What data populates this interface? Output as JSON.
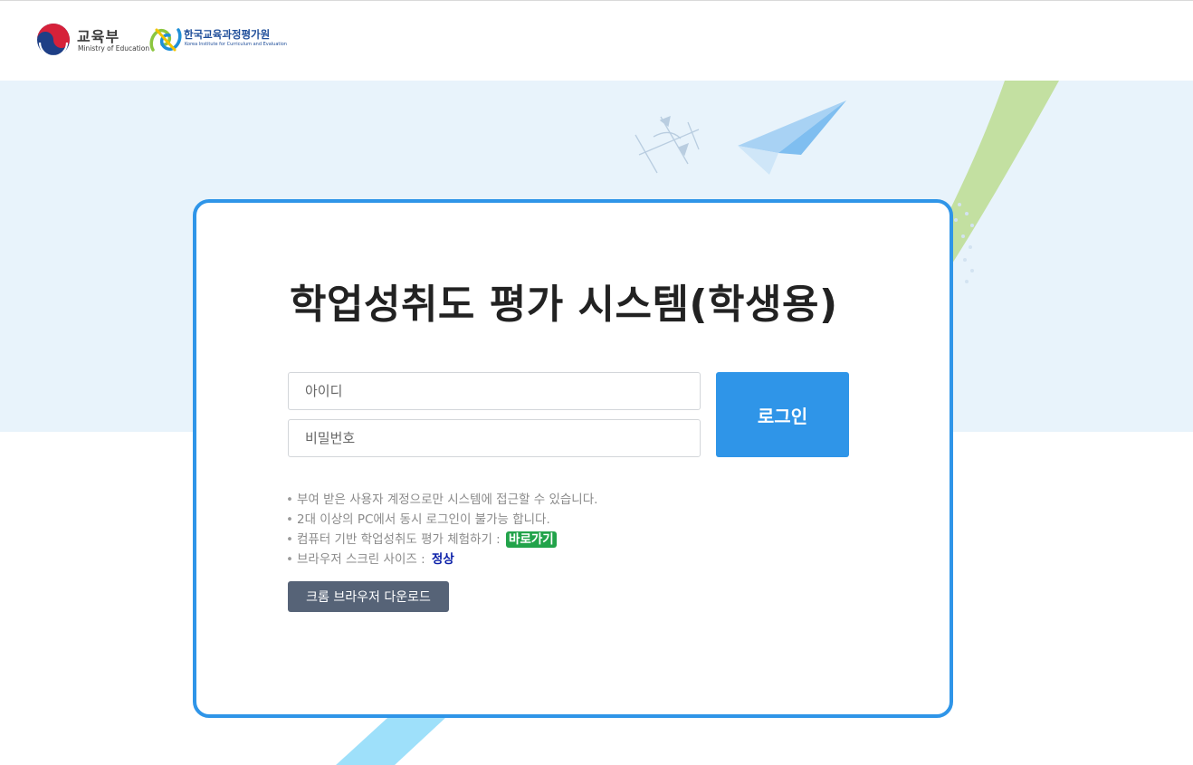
{
  "header": {
    "moe": {
      "name": "교육부",
      "name_en": "Ministry of Education"
    },
    "kice": {
      "name": "한국교육과정평가원",
      "name_en": "Korea Institute for Curriculum and Evaluation"
    }
  },
  "login": {
    "title": "학업성취도 평가 시스템(학생용)",
    "id_placeholder": "아이디",
    "password_placeholder": "비밀번호",
    "login_label": "로그인"
  },
  "notes": {
    "bullet": "•",
    "item1": "부여 받은 사용자 계정으로만 시스템에 접근할 수 있습니다.",
    "item2": "2대 이상의 PC에서 동시 로그인이 불가능 합니다.",
    "item3": "컴퓨터 기반 학업성취도 평가 체험하기 :",
    "item3_link": "바로가기",
    "item4": "브라우저 스크린 사이즈 :",
    "item4_status": "정상"
  },
  "chrome_download_label": "크롬 브라우저 다운로드",
  "colors": {
    "accent": "#2f95e8",
    "band": "#e8f3fb",
    "link_green": "#22a34a",
    "status_blue": "#0a1fa8",
    "dark_button": "#566377"
  }
}
